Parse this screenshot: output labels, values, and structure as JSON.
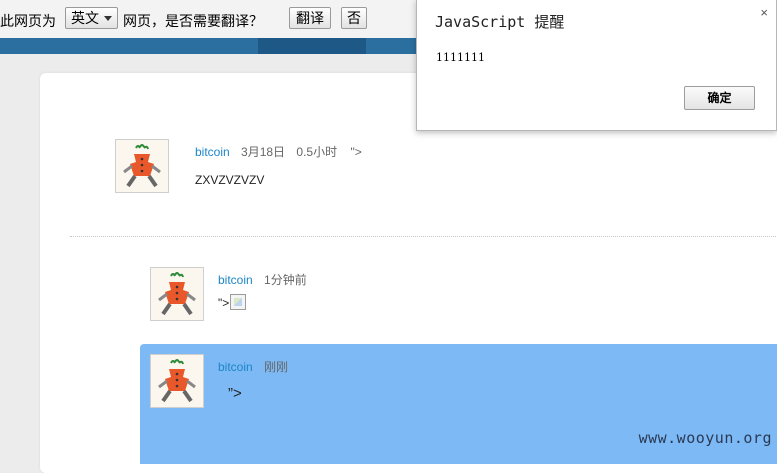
{
  "translate_bar": {
    "prefix": "此网页为",
    "language": "英文",
    "suffix": "网页，是否需要翻译？",
    "translate_button": "翻译",
    "no_button": "否"
  },
  "comments": [
    {
      "author": "bitcoin",
      "date": "3月18日",
      "duration": "0.5小时",
      "extra": "\">",
      "body": "ZXVZVZVZV"
    },
    {
      "author": "bitcoin",
      "time": "1分钟前",
      "body_prefix": "\">"
    },
    {
      "author": "bitcoin",
      "time": "刚刚",
      "body": "”>"
    }
  ],
  "alert": {
    "title": "JavaScript 提醒",
    "close": "×",
    "message": "1111111",
    "ok_button": "确定"
  },
  "watermark": "www.wooyun.org",
  "colors": {
    "author_link": "#1d86c7",
    "highlight": "#7cb9f5",
    "top_strip": "#2b6fa0"
  }
}
